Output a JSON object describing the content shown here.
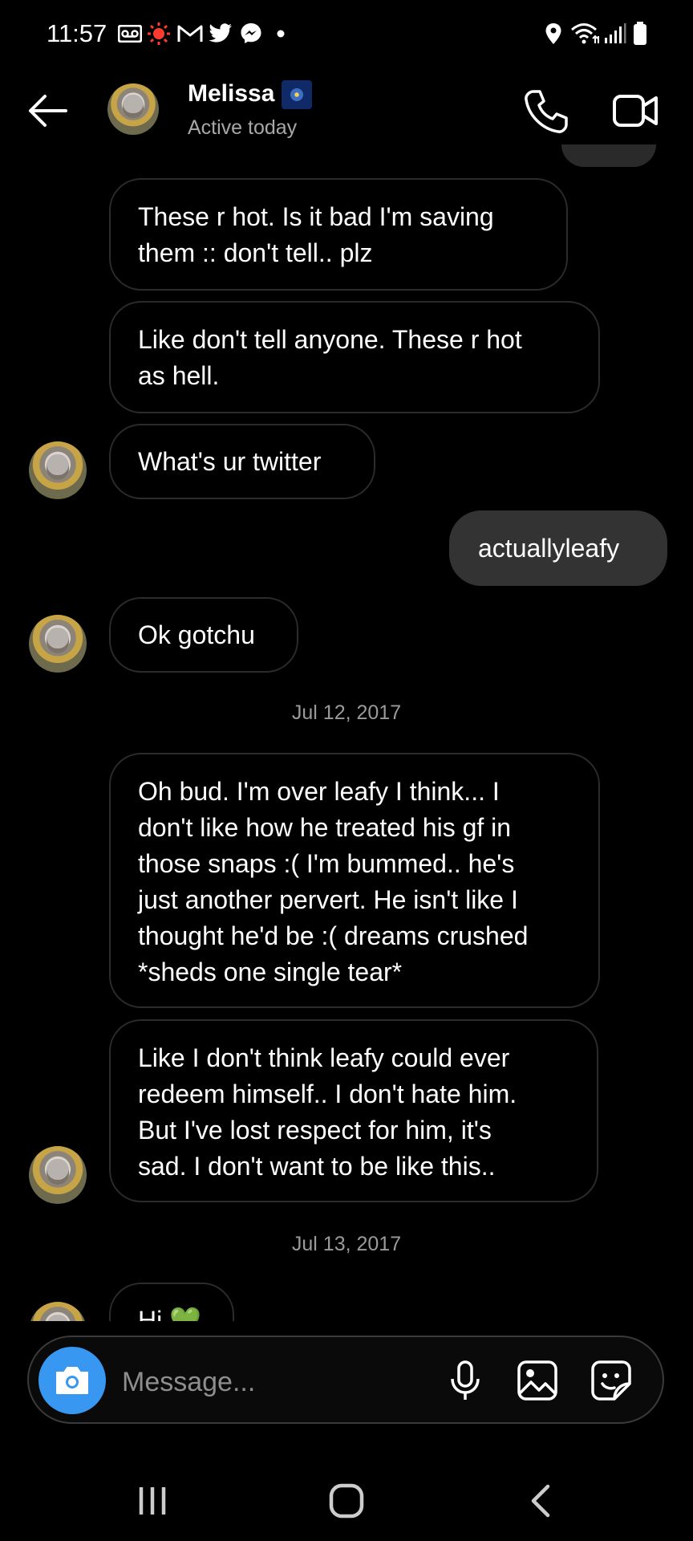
{
  "status_bar": {
    "time": "11:57",
    "left_icons": [
      "voicemail-icon",
      "record-icon",
      "gmail-icon",
      "twitter-icon",
      "messenger-icon",
      "dot-icon"
    ],
    "right_icons": [
      "location-icon",
      "wifi-icon",
      "signal-icon",
      "battery-icon"
    ]
  },
  "header": {
    "back_icon": "arrow-left-icon",
    "contact_name": "Melissa",
    "status": "Active today",
    "call_icon": "phone-icon",
    "video_icon": "video-camera-icon"
  },
  "messages": [
    {
      "text": "These r hot. Is it bad I'm saving\nthem :: don't tell.. plz",
      "direction": "received"
    },
    {
      "text": "Like don't tell anyone. These r hot\nas hell.",
      "direction": "received"
    },
    {
      "text": "What's ur twitter",
      "direction": "received"
    },
    {
      "text": "actuallyleafy",
      "direction": "sent"
    },
    {
      "text": "Ok gotchu",
      "direction": "received"
    },
    {
      "text": "Oh bud. I'm over leafy I think... I\ndon't like how he treated his gf in\nthose snaps :( I'm bummed.. he's\njust another pervert. He isn't like I\nthought he'd be :( dreams crushed\n*sheds one single tear*",
      "direction": "received"
    },
    {
      "text": "Like I don't think leafy could ever\nredeem himself.. I don't hate him.\nBut I've lost respect for him, it's\nsad. I don't want to be like this..",
      "direction": "received"
    },
    {
      "text": "Hi 💚",
      "direction": "received"
    }
  ],
  "date_separators": [
    "Jul 12, 2017",
    "Jul 13, 2017"
  ],
  "composer": {
    "placeholder": "Message...",
    "camera_icon": "camera-icon",
    "mic_icon": "microphone-icon",
    "gallery_icon": "image-icon",
    "sticker_icon": "sticker-icon"
  },
  "nav_bar": {
    "recents_icon": "recents-icon",
    "home_icon": "home-icon",
    "back_icon": "nav-back-icon"
  },
  "colors": {
    "background": "#000000",
    "sent_bubble": "#333333",
    "received_border": "#2b2b2b",
    "camera_button": "#3897f0",
    "muted_text": "#a8a8a8"
  }
}
